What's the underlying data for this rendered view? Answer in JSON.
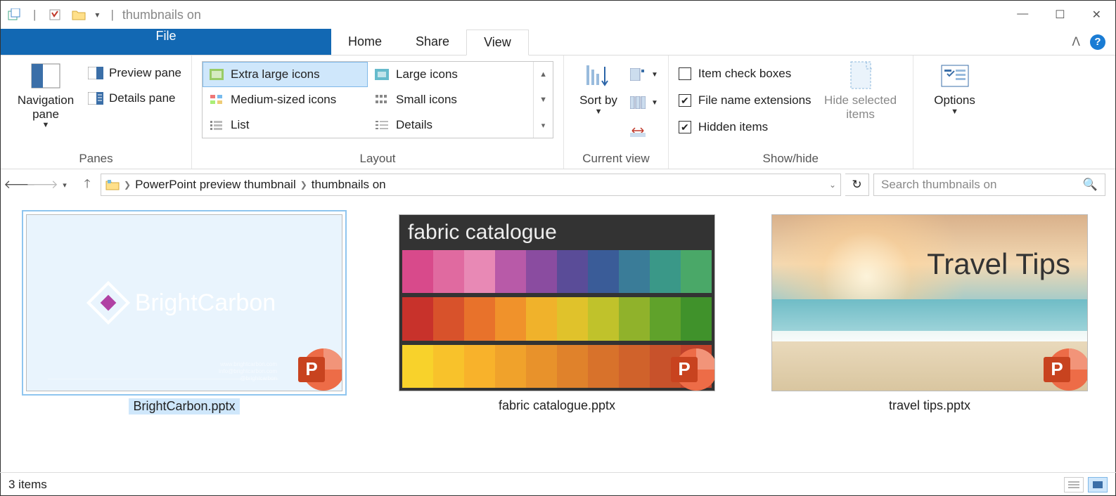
{
  "window": {
    "title": "thumbnails on"
  },
  "tabs": {
    "file": "File",
    "home": "Home",
    "share": "Share",
    "view": "View"
  },
  "ribbon": {
    "panes": {
      "nav": "Navigation pane",
      "preview": "Preview pane",
      "details": "Details pane",
      "label": "Panes"
    },
    "layout": {
      "extra_large": "Extra large icons",
      "large": "Large icons",
      "medium": "Medium-sized icons",
      "small": "Small icons",
      "list": "List",
      "details": "Details",
      "label": "Layout"
    },
    "current": {
      "sort": "Sort by",
      "label": "Current view"
    },
    "showhide": {
      "check": "Item check boxes",
      "ext": "File name extensions",
      "hidden": "Hidden items",
      "hide": "Hide selected items",
      "label": "Show/hide"
    },
    "options": "Options"
  },
  "breadcrumb": {
    "a": "PowerPoint preview thumbnail",
    "b": "thumbnails on"
  },
  "search": {
    "placeholder": "Search thumbnails on"
  },
  "files": [
    {
      "name": "BrightCarbon.pptx",
      "slide_title": "BrightCarbon"
    },
    {
      "name": "fabric catalogue.pptx",
      "slide_title": "fabric catalogue"
    },
    {
      "name": "travel tips.pptx",
      "slide_title": "Travel Tips"
    }
  ],
  "status": {
    "count": "3 items"
  }
}
